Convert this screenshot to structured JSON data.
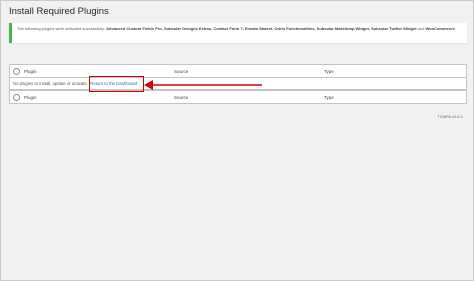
{
  "page": {
    "title": "Install Required Plugins",
    "notice_prefix": "The following plugins were activated successfully:",
    "activated_plugins": "Advanced Custom Fields Pro, Subsolar Designs Extras, Contact Form 7, Envato Market, Odrin Functionalities, Subsolar Mailchimp Widget, Subsolar Twitter Widget",
    "notice_and": "and",
    "notice_last": "WooCommerce",
    "version": "TGMPA v2.6.1"
  },
  "table": {
    "headers": [
      "Plugin",
      "Source",
      "Type"
    ],
    "footers": [
      "Plugin",
      "Source",
      "Type"
    ],
    "empty_message": "No plugins to install, update or activate.",
    "dashboard_link": "Return to the Dashboard"
  },
  "annotation": {
    "color": "#d10000"
  },
  "colors": {
    "success": "#46b450",
    "link": "#2271b1"
  }
}
